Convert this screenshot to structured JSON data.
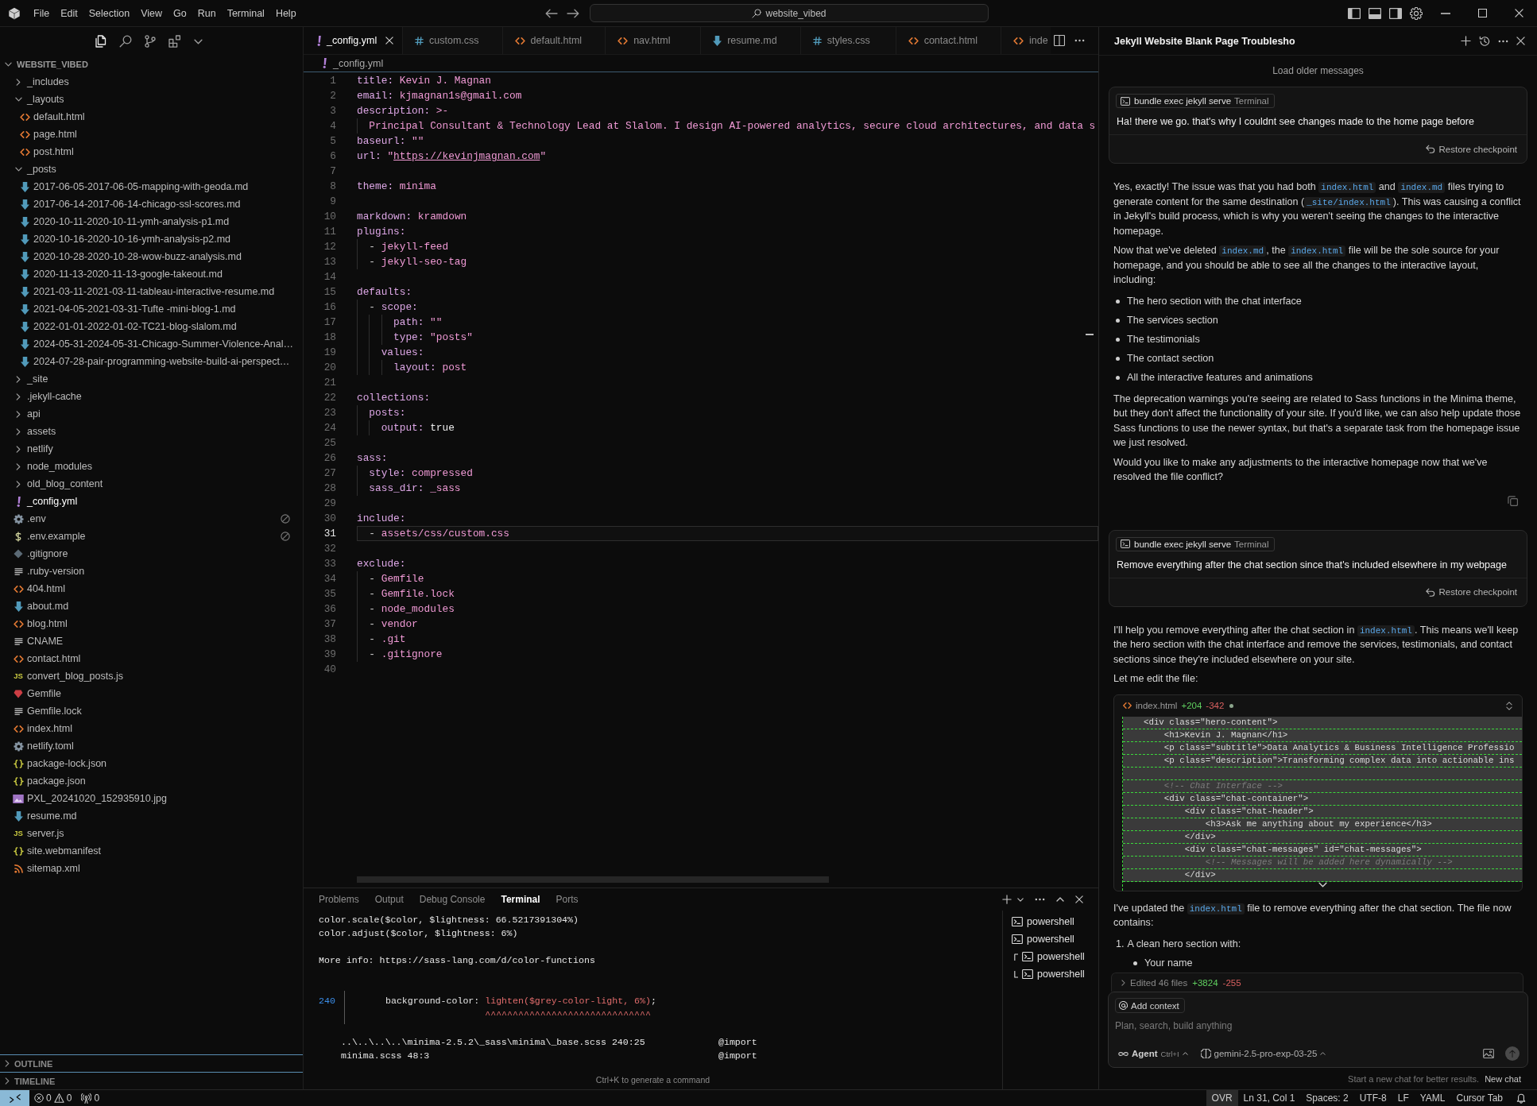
{
  "title_bar": {
    "menus": [
      "File",
      "Edit",
      "Selection",
      "View",
      "Go",
      "Run",
      "Terminal",
      "Help"
    ],
    "search": "website_vibed"
  },
  "explorer": {
    "title": "WEBSITE_VIBED",
    "expanded": true,
    "items": [
      {
        "name": "_includes",
        "kind": "folder",
        "expanded": false,
        "selected": false,
        "ignored": false
      },
      {
        "name": "_layouts",
        "kind": "folder",
        "expanded": true,
        "selected": false,
        "ignored": false,
        "children": [
          {
            "name": "default.html",
            "kind": "html",
            "selected": false,
            "ignored": false
          },
          {
            "name": "page.html",
            "kind": "html",
            "selected": false,
            "ignored": false
          },
          {
            "name": "post.html",
            "kind": "html",
            "selected": false,
            "ignored": false
          }
        ]
      },
      {
        "name": "_posts",
        "kind": "folder",
        "expanded": true,
        "selected": false,
        "ignored": false,
        "children": [
          {
            "name": "2017-06-05-2017-06-05-mapping-with-geoda.md",
            "kind": "md",
            "selected": false,
            "ignored": false
          },
          {
            "name": "2017-06-14-2017-06-14-chicago-ssl-scores.md",
            "kind": "md",
            "selected": false,
            "ignored": false
          },
          {
            "name": "2020-10-11-2020-10-11-ymh-analysis-p1.md",
            "kind": "md",
            "selected": false,
            "ignored": false
          },
          {
            "name": "2020-10-16-2020-10-16-ymh-analysis-p2.md",
            "kind": "md",
            "selected": false,
            "ignored": false
          },
          {
            "name": "2020-10-28-2020-10-28-wow-buzz-analysis.md",
            "kind": "md",
            "selected": false,
            "ignored": false
          },
          {
            "name": "2020-11-13-2020-11-13-google-takeout.md",
            "kind": "md",
            "selected": false,
            "ignored": false
          },
          {
            "name": "2021-03-11-2021-03-11-tableau-interactive-resume.md",
            "kind": "md",
            "selected": false,
            "ignored": false
          },
          {
            "name": "2021-04-05-2021-03-31-Tufte -mini-blog-1.md",
            "kind": "md",
            "selected": false,
            "ignored": false
          },
          {
            "name": "2022-01-01-2022-01-02-TC21-blog-slalom.md",
            "kind": "md",
            "selected": false,
            "ignored": false
          },
          {
            "name": "2024-05-31-2024-05-31-Chicago-Summer-Violence-Anal…",
            "kind": "md",
            "selected": false,
            "ignored": false
          },
          {
            "name": "2024-07-28-pair-programming-website-build-ai-perspect…",
            "kind": "md",
            "selected": false,
            "ignored": false
          }
        ]
      },
      {
        "name": "_site",
        "kind": "folder",
        "expanded": false,
        "selected": false,
        "ignored": false
      },
      {
        "name": ".jekyll-cache",
        "kind": "folder",
        "expanded": false,
        "selected": false,
        "ignored": false
      },
      {
        "name": "api",
        "kind": "folder",
        "expanded": false,
        "selected": false,
        "ignored": false
      },
      {
        "name": "assets",
        "kind": "folder",
        "expanded": false,
        "selected": false,
        "ignored": false
      },
      {
        "name": "netlify",
        "kind": "folder",
        "expanded": false,
        "selected": false,
        "ignored": false
      },
      {
        "name": "node_modules",
        "kind": "folder",
        "expanded": false,
        "selected": false,
        "ignored": false
      },
      {
        "name": "old_blog_content",
        "kind": "folder",
        "expanded": false,
        "selected": false,
        "ignored": false
      },
      {
        "name": "_config.yml",
        "kind": "yaml",
        "selected": true,
        "ignored": false
      },
      {
        "name": ".env",
        "kind": "gear",
        "selected": false,
        "ignored": true
      },
      {
        "name": ".env.example",
        "kind": "dollar",
        "selected": false,
        "ignored": true
      },
      {
        "name": ".gitignore",
        "kind": "git",
        "selected": false,
        "ignored": false
      },
      {
        "name": ".ruby-version",
        "kind": "text",
        "selected": false,
        "ignored": false
      },
      {
        "name": "404.html",
        "kind": "html",
        "selected": false,
        "ignored": false
      },
      {
        "name": "about.md",
        "kind": "md",
        "selected": false,
        "ignored": false
      },
      {
        "name": "blog.html",
        "kind": "html",
        "selected": false,
        "ignored": false
      },
      {
        "name": "CNAME",
        "kind": "text",
        "selected": false,
        "ignored": false
      },
      {
        "name": "contact.html",
        "kind": "html",
        "selected": false,
        "ignored": false
      },
      {
        "name": "convert_blog_posts.js",
        "kind": "js",
        "icon_text": "JS",
        "selected": false,
        "ignored": false
      },
      {
        "name": "Gemfile",
        "kind": "ruby",
        "selected": false,
        "ignored": false
      },
      {
        "name": "Gemfile.lock",
        "kind": "text",
        "selected": false,
        "ignored": false
      },
      {
        "name": "index.html",
        "kind": "html",
        "selected": false,
        "ignored": false
      },
      {
        "name": "netlify.toml",
        "kind": "gear",
        "selected": false,
        "ignored": false
      },
      {
        "name": "package-lock.json",
        "kind": "json",
        "selected": false,
        "ignored": false
      },
      {
        "name": "package.json",
        "kind": "json",
        "selected": false,
        "ignored": false
      },
      {
        "name": "PXL_20241020_152935910.jpg",
        "kind": "image",
        "selected": false,
        "ignored": false
      },
      {
        "name": "resume.md",
        "kind": "md",
        "selected": false,
        "ignored": false
      },
      {
        "name": "server.js",
        "kind": "js",
        "icon_text": "JS",
        "selected": false,
        "ignored": false
      },
      {
        "name": "site.webmanifest",
        "kind": "json",
        "selected": false,
        "ignored": false
      },
      {
        "name": "sitemap.xml",
        "kind": "rss",
        "selected": false,
        "ignored": false
      }
    ],
    "sections": [
      {
        "title": "OUTLINE",
        "expanded": false
      },
      {
        "title": "TIMELINE",
        "expanded": false
      }
    ]
  },
  "editor": {
    "tabs": [
      {
        "label": "_config.yml",
        "kind": "yaml",
        "selected": true
      },
      {
        "label": "custom.css",
        "kind": "css",
        "selected": false
      },
      {
        "label": "default.html",
        "kind": "html",
        "selected": false
      },
      {
        "label": "nav.html",
        "kind": "html",
        "selected": false
      },
      {
        "label": "resume.md",
        "kind": "md",
        "selected": false
      },
      {
        "label": "styles.css",
        "kind": "css",
        "selected": false
      },
      {
        "label": "contact.html",
        "kind": "html",
        "selected": false
      },
      {
        "label": "inde",
        "kind": "html",
        "selected": false
      }
    ],
    "breadcrumb": {
      "label": "_config.yml",
      "kind": "yaml"
    },
    "lines": [
      {
        "number": "1",
        "current": false,
        "code": [
          {
            "kind": "key",
            "text": "title:"
          },
          {
            "kind": "value",
            "text": " Kevin J. Magnan"
          }
        ]
      },
      {
        "number": "2",
        "current": false,
        "code": [
          {
            "kind": "key",
            "text": "email:"
          },
          {
            "kind": "value",
            "text": " kjmagnan1s@gmail.com"
          }
        ]
      },
      {
        "number": "3",
        "current": false,
        "code": [
          {
            "kind": "key",
            "text": "description:"
          },
          {
            "kind": "value",
            "text": " >-"
          }
        ]
      },
      {
        "number": "4",
        "current": false,
        "code": [
          {
            "kind": "value",
            "text": "  Principal Consultant & Technology Lead at Slalom. I design AI-powered analytics, secure cloud architectures, and data s"
          }
        ]
      },
      {
        "number": "5",
        "current": false,
        "code": [
          {
            "kind": "key",
            "text": "baseurl:"
          },
          {
            "kind": "value",
            "text": " \"\""
          }
        ]
      },
      {
        "number": "6",
        "current": false,
        "code": [
          {
            "kind": "key",
            "text": "url:"
          },
          {
            "kind": "value",
            "text": " \""
          },
          {
            "kind": "link",
            "text": "https://kevinjmagnan.com"
          },
          {
            "kind": "value",
            "text": "\""
          }
        ]
      },
      {
        "number": "7",
        "current": false
      },
      {
        "number": "8",
        "current": false,
        "code": [
          {
            "kind": "key",
            "text": "theme:"
          },
          {
            "kind": "value",
            "text": " minima"
          }
        ]
      },
      {
        "number": "9",
        "current": false
      },
      {
        "number": "10",
        "current": false,
        "code": [
          {
            "kind": "key",
            "text": "markdown:"
          },
          {
            "kind": "value",
            "text": " kramdown"
          }
        ]
      },
      {
        "number": "11",
        "current": false,
        "code": [
          {
            "kind": "key",
            "text": "plugins:"
          }
        ]
      },
      {
        "number": "12",
        "current": false,
        "code": [
          {
            "kind": "plain",
            "text": "  - "
          },
          {
            "kind": "value",
            "text": "jekyll-feed"
          }
        ]
      },
      {
        "number": "13",
        "current": false,
        "code": [
          {
            "kind": "plain",
            "text": "  - "
          },
          {
            "kind": "value",
            "text": "jekyll-seo-tag"
          }
        ]
      },
      {
        "number": "14",
        "current": false
      },
      {
        "number": "15",
        "current": false,
        "code": [
          {
            "kind": "key",
            "text": "defaults:"
          }
        ]
      },
      {
        "number": "16",
        "current": false,
        "code": [
          {
            "kind": "plain",
            "text": "  - "
          },
          {
            "kind": "key",
            "text": "scope:"
          }
        ]
      },
      {
        "number": "17",
        "current": false,
        "code": [
          {
            "kind": "key",
            "text": "      path:"
          },
          {
            "kind": "value",
            "text": " \"\""
          }
        ]
      },
      {
        "number": "18",
        "current": false,
        "code": [
          {
            "kind": "key",
            "text": "      type:"
          },
          {
            "kind": "value",
            "text": " \"posts\""
          }
        ]
      },
      {
        "number": "19",
        "current": false,
        "code": [
          {
            "kind": "key",
            "text": "    values:"
          }
        ]
      },
      {
        "number": "20",
        "current": false,
        "code": [
          {
            "kind": "key",
            "text": "      layout:"
          },
          {
            "kind": "value",
            "text": " post"
          }
        ]
      },
      {
        "number": "21",
        "current": false
      },
      {
        "number": "22",
        "current": false,
        "code": [
          {
            "kind": "key",
            "text": "collections:"
          }
        ]
      },
      {
        "number": "23",
        "current": false,
        "code": [
          {
            "kind": "key",
            "text": "  posts:"
          }
        ]
      },
      {
        "number": "24",
        "current": false,
        "code": [
          {
            "kind": "key",
            "text": "    output:"
          },
          {
            "kind": "const",
            "text": " true"
          }
        ]
      },
      {
        "number": "25",
        "current": false
      },
      {
        "number": "26",
        "current": false,
        "code": [
          {
            "kind": "key",
            "text": "sass:"
          }
        ]
      },
      {
        "number": "27",
        "current": false,
        "code": [
          {
            "kind": "key",
            "text": "  style:"
          },
          {
            "kind": "value",
            "text": " compressed"
          }
        ]
      },
      {
        "number": "28",
        "current": false,
        "code": [
          {
            "kind": "key",
            "text": "  sass_dir:"
          },
          {
            "kind": "value",
            "text": " _sass"
          }
        ]
      },
      {
        "number": "29",
        "current": false
      },
      {
        "number": "30",
        "current": false,
        "code": [
          {
            "kind": "key",
            "text": "include:"
          }
        ]
      },
      {
        "number": "31",
        "current": true,
        "code": [
          {
            "kind": "plain",
            "text": "  - "
          },
          {
            "kind": "value",
            "text": "assets/css/custom.css"
          }
        ]
      },
      {
        "number": "32",
        "current": false
      },
      {
        "number": "33",
        "current": false,
        "code": [
          {
            "kind": "key",
            "text": "exclude:"
          }
        ]
      },
      {
        "number": "34",
        "current": false,
        "code": [
          {
            "kind": "plain",
            "text": "  - "
          },
          {
            "kind": "value",
            "text": "Gemfile"
          }
        ]
      },
      {
        "number": "35",
        "current": false,
        "code": [
          {
            "kind": "plain",
            "text": "  - "
          },
          {
            "kind": "value",
            "text": "Gemfile.lock"
          }
        ]
      },
      {
        "number": "36",
        "current": false,
        "code": [
          {
            "kind": "plain",
            "text": "  - "
          },
          {
            "kind": "value",
            "text": "node_modules"
          }
        ]
      },
      {
        "number": "37",
        "current": false,
        "code": [
          {
            "kind": "plain",
            "text": "  - "
          },
          {
            "kind": "value",
            "text": "vendor"
          }
        ]
      },
      {
        "number": "38",
        "current": false,
        "code": [
          {
            "kind": "plain",
            "text": "  - "
          },
          {
            "kind": "value",
            "text": ".git"
          }
        ]
      },
      {
        "number": "39",
        "current": false,
        "code": [
          {
            "kind": "plain",
            "text": "  - "
          },
          {
            "kind": "value",
            "text": ".gitignore"
          }
        ]
      },
      {
        "number": "40",
        "current": false
      }
    ]
  },
  "panel": {
    "tabs": [
      {
        "label": "Problems",
        "selected": false
      },
      {
        "label": "Output",
        "selected": false
      },
      {
        "label": "Debug Console",
        "selected": false
      },
      {
        "label": "Terminal",
        "selected": true
      },
      {
        "label": "Ports",
        "selected": false
      }
    ],
    "terminal": {
      "blocks": [
        {
          "kind": "output",
          "lines": [
            "color.scale($color, $lightness: 66.5217391304%)",
            "color.adjust($color, $lightness: 6%)"
          ]
        },
        {
          "kind": "output",
          "lines": [
            "More info: https://sass-lang.com/d/color-functions"
          ]
        },
        {
          "kind": "excerpt",
          "line_number": "240",
          "code": "background-color: ",
          "error": "lighten($grey-color-light, 6%)",
          "tail": ";",
          "carets": "^^^^^^^^^^^^^^^^^^^^^^^^^^^^^^"
        },
        {
          "kind": "trace",
          "lines": [
            {
              "location": "..\\..\\..\\..\\minima-2.5.2\\_sass\\minima\\_base.scss 240:25",
              "rule": "@import"
            },
            {
              "location": "minima.scss 48:3",
              "rule": "@import"
            }
          ]
        }
      ],
      "hint": "Ctrl+K to generate a command"
    },
    "sessions": [
      {
        "kind": "single",
        "label": "powershell"
      },
      {
        "kind": "single",
        "label": "powershell"
      },
      {
        "kind": "group",
        "children": [
          {
            "label": "powershell"
          },
          {
            "label": "powershell"
          }
        ]
      }
    ]
  },
  "chat": {
    "title": "Jekyll Website Blank Page Troublesho",
    "load_older": "Load older messages",
    "messages": [
      {
        "kind": "user",
        "context": {
          "label": "bundle exec jekyll serve",
          "source": "Terminal"
        },
        "text": "Ha! there we go. that's why I couldnt see changes made to the home page before",
        "restore": "Restore checkpoint"
      },
      {
        "kind": "assistant",
        "copyable": true,
        "blocks": [
          {
            "kind": "paragraph",
            "parts": [
              {
                "kind": "text",
                "text": "Yes, exactly! The issue was that you had both "
              },
              {
                "kind": "code",
                "text": "index.html"
              },
              {
                "kind": "text",
                "text": " and "
              },
              {
                "kind": "code",
                "text": "index.md"
              },
              {
                "kind": "text",
                "text": " files trying to generate content for the same destination ("
              },
              {
                "kind": "code",
                "text": "_site/index.html"
              },
              {
                "kind": "text",
                "text": "). This was causing a conflict in Jekyll's build process, which is why you weren't seeing the changes to the interactive homepage."
              }
            ]
          },
          {
            "kind": "paragraph",
            "parts": [
              {
                "kind": "text",
                "text": "Now that we've deleted "
              },
              {
                "kind": "code",
                "text": "index.md"
              },
              {
                "kind": "text",
                "text": ", the "
              },
              {
                "kind": "code",
                "text": "index.html"
              },
              {
                "kind": "text",
                "text": " file will be the sole source for your homepage, and you should be able to see all the changes to the interactive layout, including:"
              }
            ]
          },
          {
            "kind": "bullets",
            "items": [
              "The hero section with the chat interface",
              "The services section",
              "The testimonials",
              "The contact section",
              "All the interactive features and animations"
            ]
          },
          {
            "kind": "paragraph",
            "parts": [
              {
                "kind": "text",
                "text": "The deprecation warnings you're seeing are related to Sass functions in the Minima theme, but they don't affect the functionality of your site. If you'd like, we can also help update those Sass functions to use the newer syntax, but that's a separate task from the homepage issue we just resolved."
              }
            ]
          },
          {
            "kind": "paragraph",
            "parts": [
              {
                "kind": "text",
                "text": "Would you like to make any adjustments to the interactive homepage now that we've resolved the file conflict?"
              }
            ]
          }
        ]
      },
      {
        "kind": "user",
        "context": {
          "label": "bundle exec jekyll serve",
          "source": "Terminal"
        },
        "text": "Remove everything after the chat section since that's included elsewhere in my webpage",
        "restore": "Restore checkpoint"
      },
      {
        "kind": "assistant",
        "copyable": false,
        "blocks": [
          {
            "kind": "paragraph",
            "parts": [
              {
                "kind": "text",
                "text": "I'll help you remove everything after the chat section in "
              },
              {
                "kind": "code",
                "text": "index.html"
              },
              {
                "kind": "text",
                "text": ". This means we'll keep the hero section with the chat interface and remove the services, testimonials, and contact sections since they're included elsewhere on your site."
              }
            ]
          },
          {
            "kind": "paragraph",
            "parts": [
              {
                "kind": "text",
                "text": "Let me edit the file:"
              }
            ]
          },
          {
            "kind": "diff",
            "file": "index.html",
            "added": "+204",
            "removed": "-342",
            "lines": [
              {
                "kind": "code",
                "text": "    <div class=\"hero-content\">"
              },
              {
                "kind": "code",
                "text": "        <h1>Kevin J. Magnan</h1>"
              },
              {
                "kind": "code",
                "text": "        <p class=\"subtitle\">Data Analytics & Business Intelligence Professio"
              },
              {
                "kind": "code",
                "text": "        <p class=\"description\">Transforming complex data into actionable ins"
              },
              {
                "kind": "blank"
              },
              {
                "kind": "comment",
                "text": "        <!-- Chat Interface -->"
              },
              {
                "kind": "code",
                "text": "        <div class=\"chat-container\">"
              },
              {
                "kind": "code",
                "text": "            <div class=\"chat-header\">"
              },
              {
                "kind": "code",
                "text": "                <h3>Ask me anything about my experience</h3>"
              },
              {
                "kind": "code",
                "text": "            </div>"
              },
              {
                "kind": "code",
                "text": "            <div class=\"chat-messages\" id=\"chat-messages\">"
              },
              {
                "kind": "comment",
                "text": "                <!-- Messages will be added here dynamically -->"
              },
              {
                "kind": "code",
                "text": "            </div>"
              }
            ]
          },
          {
            "kind": "paragraph",
            "parts": [
              {
                "kind": "text",
                "text": "I've updated the "
              },
              {
                "kind": "code",
                "text": "index.html"
              },
              {
                "kind": "text",
                "text": " file to remove everything after the chat section. The file now contains:"
              }
            ]
          },
          {
            "kind": "numbered",
            "items": [
              {
                "number": "1.",
                "text": "A clean hero section with:",
                "children": [
                  "Your name"
                ]
              }
            ]
          }
        ]
      }
    ],
    "edited": {
      "label": "Edited 46 files",
      "added": "+3824",
      "removed": "-255"
    },
    "input": {
      "context_button": "Add context",
      "placeholder": "Plan, search, build anything",
      "mode": "Agent",
      "mode_shortcut": "Ctrl+I",
      "model": "gemini-2.5-pro-exp-03-25",
      "send_disabled": true
    },
    "footer": {
      "hint": "Start a new chat for better results.",
      "link": "New chat"
    }
  },
  "status_bar": {
    "problems": {
      "errors": "0",
      "warnings": "0"
    },
    "ports": "0",
    "items": [
      {
        "text": "OVR",
        "highlighted": true
      },
      {
        "text": "Ln 31, Col 1",
        "highlighted": false
      },
      {
        "text": "Spaces: 2",
        "highlighted": false
      },
      {
        "text": "UTF-8",
        "highlighted": false
      },
      {
        "text": "LF",
        "highlighted": false
      },
      {
        "text": "YAML",
        "highlighted": false
      },
      {
        "text": "Cursor Tab",
        "highlighted": false
      }
    ]
  }
}
